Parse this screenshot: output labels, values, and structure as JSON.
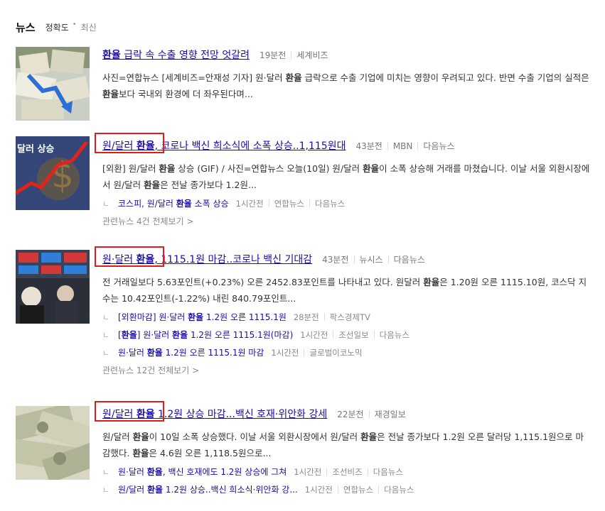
{
  "header": {
    "title": "뉴스",
    "sort_accuracy": "정확도",
    "sort_latest": "최신"
  },
  "items": [
    {
      "title": "환율 급락 속 수출 영향 전망 엇갈려",
      "time": "19분전",
      "source": "세계비즈",
      "desc": "사진=연합뉴스 [세계비즈=안재성 기자] 원·달러 환율 급락으로 수출 기업에 미치는 영향이 우려되고 있다. 반면 수출 기업의 실적은 환율보다 국내외 환경에 더 좌우된다며..."
    },
    {
      "title": "원/달러 환율, 코로나 백신 희소식에 소폭 상승..1,115원대",
      "time": "43분전",
      "source": "MBN",
      "via": "다음뉴스",
      "desc": "[외환] 원/달러 환율 상승 (GIF) / 사진=연합뉴스 오늘(10일) 원/달러 환율이 소폭 상승해 거래를 마쳤습니다. 이날 서울 외환시장에서 원/달러 환율은 전날 종가보다 1.2원...",
      "thumb_text": "달러 상승",
      "related": [
        {
          "title": "코스피, 원/달러 환율 소폭 상승",
          "time": "1시간전",
          "source": "연합뉴스",
          "via": "다음뉴스"
        }
      ],
      "more": "관련뉴스 4건 전체보기 >"
    },
    {
      "title": "원·달러 환율, 1115.1원 마감..코로나 백신 기대감",
      "time": "43분전",
      "source": "뉴시스",
      "via": "다음뉴스",
      "desc": "전 거래일보다 5.63포인트(+0.23%) 오른 2452.83포인트를 나타내고 있다. 원달러 환율은 1.20원 오른 1115.10원, 코스닥 지수는 10.42포인트(-1.22%) 내린 840.79포인트...",
      "related": [
        {
          "title": "[외환마감] 원·달러 환율 1.2원 오른 1115.1원",
          "time": "28분전",
          "source": "팍스경제TV"
        },
        {
          "title": "[환율] 원·달러 환율 1.2원 오른 1115.1원(마감)",
          "time": "1시간전",
          "source": "조선일보",
          "via": "다음뉴스"
        },
        {
          "title": "원·달러 환율 1.2원 오른 1115.1원 마감",
          "time": "1시간전",
          "source": "글로벌이코노믹"
        }
      ],
      "more": "관련뉴스 12건 전체보기 >"
    },
    {
      "title": "원/달러 환율 1.2원 상승 마감...백신 호재·위안화 강세",
      "time": "22분전",
      "source": "재경일보",
      "desc": "원/달러 환율이 10일 소폭 상승했다. 이날 서울 외환시장에서 원/달러 환율은 전날 종가보다 1.2원 오른 달러당 1,115.1원으로 마감했다. 환율은 4.6원 오른 1,118.5원으로...",
      "related": [
        {
          "title": "원·달러 환율, 백신 호재에도 1.2원 상승에 그쳐",
          "time": "1시간전",
          "source": "조선비즈",
          "via": "다음뉴스"
        },
        {
          "title": "원/달러 환율 1.2원 상승..백신 희소식·위안화 강...",
          "time": "1시간전",
          "source": "연합뉴스",
          "via": "다음뉴스"
        }
      ]
    }
  ],
  "colors": {
    "link": "#1a0dab",
    "highlight_box": "#e01b1b",
    "meta": "#777777"
  }
}
